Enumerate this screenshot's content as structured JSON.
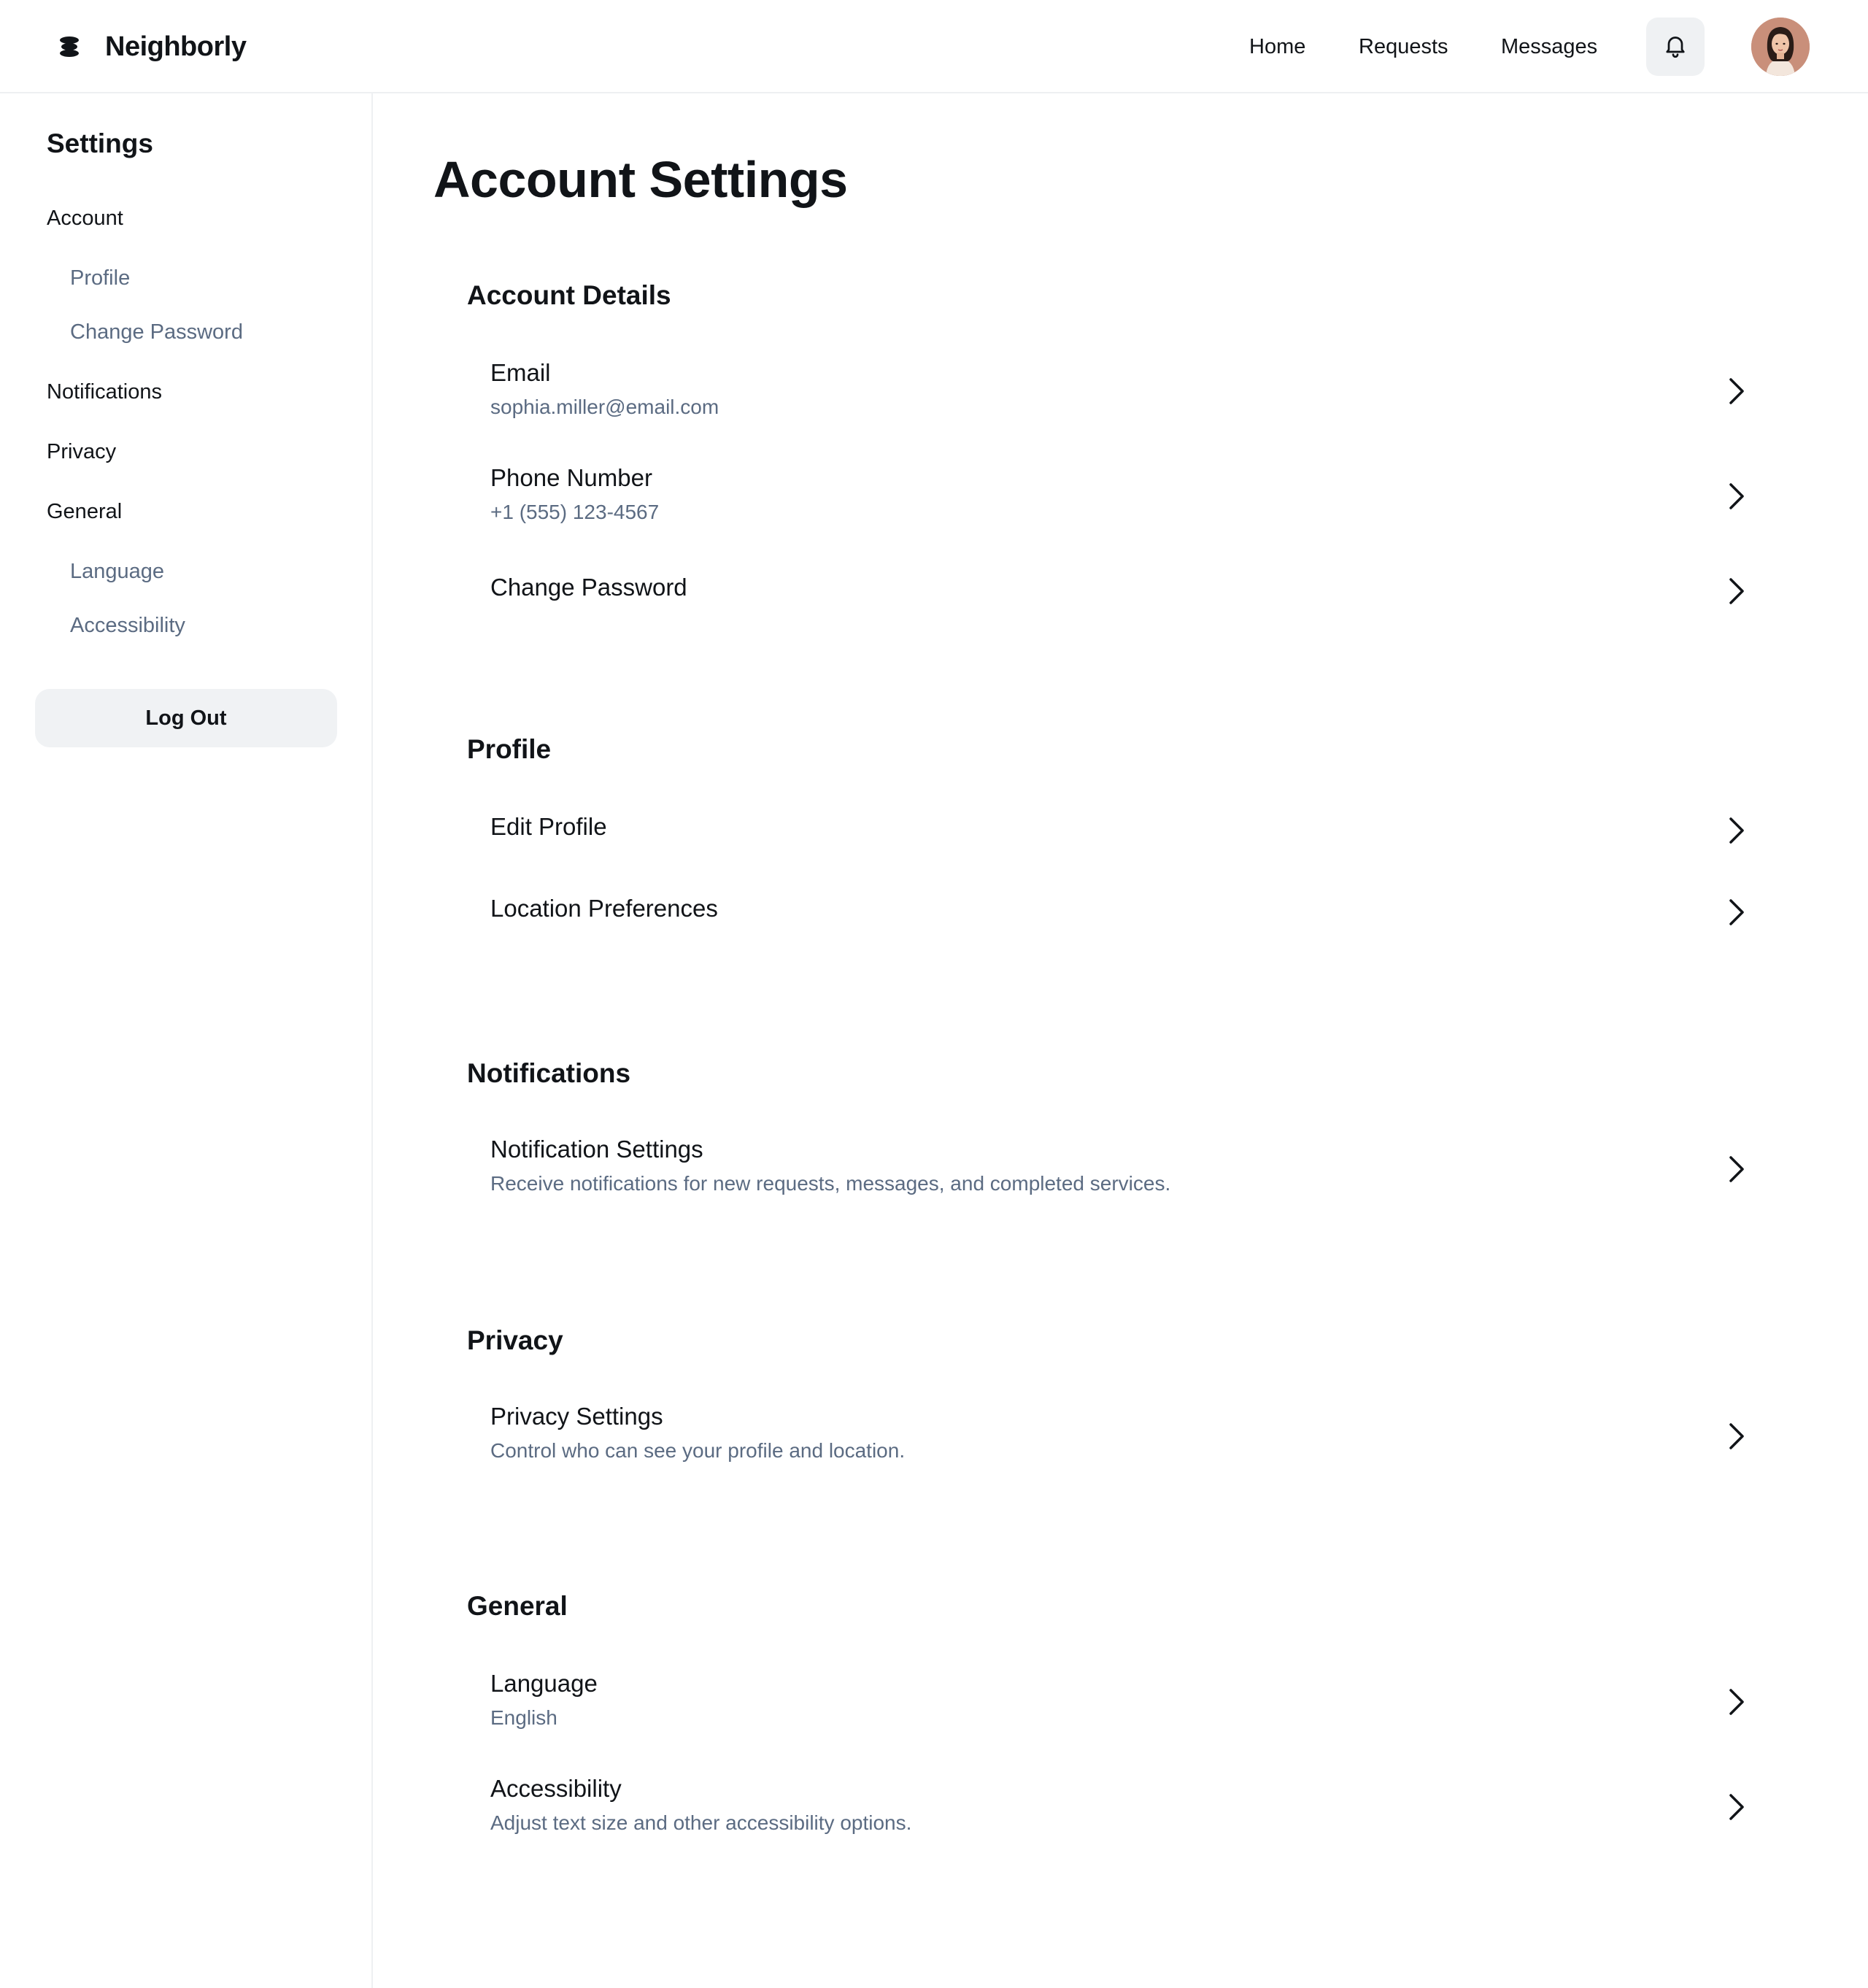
{
  "app": {
    "name": "Neighborly"
  },
  "nav": {
    "home": "Home",
    "requests": "Requests",
    "messages": "Messages"
  },
  "sidebar": {
    "title": "Settings",
    "account": "Account",
    "profile": "Profile",
    "change_password": "Change Password",
    "notifications": "Notifications",
    "privacy": "Privacy",
    "general": "General",
    "language": "Language",
    "accessibility": "Accessibility",
    "logout": "Log Out"
  },
  "main": {
    "title": "Account Settings",
    "account_details": {
      "title": "Account Details",
      "email_label": "Email",
      "email_value": "sophia.miller@email.com",
      "phone_label": "Phone Number",
      "phone_value": "+1 (555) 123-4567",
      "password_label": "Change Password"
    },
    "profile": {
      "title": "Profile",
      "edit_label": "Edit Profile",
      "location_label": "Location Preferences"
    },
    "notifications": {
      "title": "Notifications",
      "settings_label": "Notification Settings",
      "settings_desc": "Receive notifications for new requests, messages, and completed services."
    },
    "privacy": {
      "title": "Privacy",
      "settings_label": "Privacy Settings",
      "settings_desc": "Control who can see your profile and location."
    },
    "general": {
      "title": "General",
      "language_label": "Language",
      "language_value": "English",
      "accessibility_label": "Accessibility",
      "accessibility_desc": "Adjust text size and other accessibility options."
    }
  },
  "colors": {
    "text": "#111418",
    "muted": "#5b6b82",
    "button_bg": "#f0f2f4"
  }
}
